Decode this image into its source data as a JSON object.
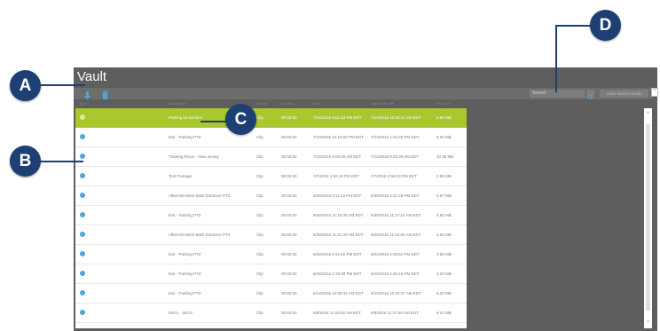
{
  "window": {
    "title": "Vault"
  },
  "toolbar": {
    "download_icon": "download-icon",
    "delete_icon": "trash-icon",
    "search_placeholder": "Search",
    "clear_label": "Clear search results"
  },
  "columns": {
    "type": "Type",
    "description": "Description",
    "source": "Source",
    "duration": "Duration",
    "start": "Start",
    "date_added": "Date added",
    "size": "File size"
  },
  "rows": [
    {
      "description": "Parking lot incident",
      "type": "Clip",
      "duration": "00:02:00",
      "start": "7/14/2016 4:01:43 PM EDT",
      "added": "7/14/2016 10:42:11 AM EDT",
      "size": "5.90 MB"
    },
    {
      "description": "Exit - Parking PTZ",
      "type": "Clip",
      "duration": "00:02:00",
      "start": "7/13/2016 12:16:09 PM EDT",
      "added": "7/13/2016 1:42:28 PM EDT",
      "size": "8.20 MB"
    },
    {
      "description": "Training Room - New Jersey",
      "type": "Clip",
      "duration": "00:02:00",
      "start": "7/12/2016 9:08:48 AM EDT",
      "added": "7/12/2016 9:29:36 AM EDT",
      "size": "10.38 MB"
    },
    {
      "description": "Test Footage",
      "type": "Clip",
      "duration": "00:02:00",
      "start": "7/7/2016 1:52:16 PM EDT",
      "added": "7/7/2016 2:58:23 PM EDT",
      "size": "2.96 MB"
    },
    {
      "description": "Albert-Einstein-Main Entrance PTZ",
      "type": "Clip",
      "duration": "00:02:00",
      "start": "6/30/2016 3:11:43 PM EDT",
      "added": "6/30/2016 3:21:28 PM EDT",
      "size": "6.87 MB"
    },
    {
      "description": "Exit - Parking PTZ",
      "type": "Clip",
      "duration": "00:02:00",
      "start": "6/30/2016 11:15:36 AM EDT",
      "added": "6/30/2016 11:17:14 AM EDT",
      "size": "4.80 MB"
    },
    {
      "description": "Albert-Einstein-Main Entrance PTZ",
      "type": "Clip",
      "duration": "00:02:00",
      "start": "6/29/2016 11:21:20 AM EDT",
      "added": "6/29/2016 11:34:02 AM EDT",
      "size": "2.52 MB"
    },
    {
      "description": "Exit - Parking PTZ",
      "type": "Clip",
      "duration": "00:02:00",
      "start": "6/22/2016 2:31:52 PM EDT",
      "added": "6/22/2016 2:35:54 PM EDT",
      "size": "0.83 MB"
    },
    {
      "description": "Exit - Parking PTZ",
      "type": "Clip",
      "duration": "00:02:00",
      "start": "6/15/2016 2:18:28 PM EDT",
      "added": "6/15/2016 2:45:15 PM EDT",
      "size": "4.22 MB"
    },
    {
      "description": "Exit - Parking PTZ",
      "type": "Clip",
      "duration": "00:02:00",
      "start": "6/14/2016 10:30:32 AM EDT",
      "added": "6/14/2016 10:24:37 AM EDT",
      "size": "9.25 MB"
    },
    {
      "description": "Eleco - 2ECS",
      "type": "Clip",
      "duration": "00:02:00",
      "start": "6/9/2016 11:04:52 AM EDT",
      "added": "6/9/2016 11:27:50 AM EDT",
      "size": "9.21 MB"
    }
  ],
  "callouts": {
    "a": "A",
    "b": "B",
    "c": "C",
    "d": "D"
  }
}
